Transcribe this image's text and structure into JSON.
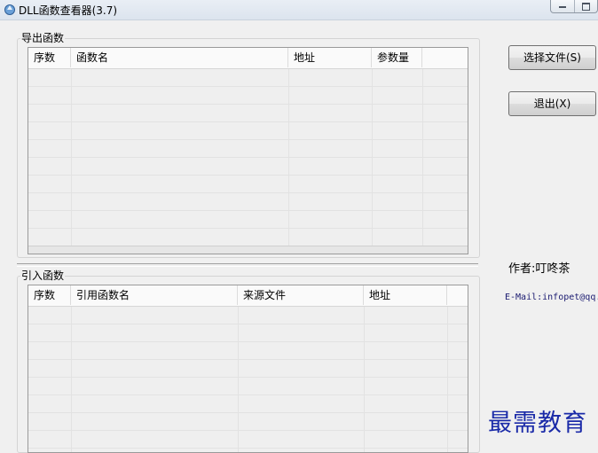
{
  "window": {
    "title": "DLL函数查看器(3.7)"
  },
  "exports": {
    "group_label": "导出函数",
    "columns": [
      "序数",
      "函数名",
      "地址",
      "参数量"
    ]
  },
  "imports": {
    "group_label": "引入函数",
    "columns": [
      "序数",
      "引用函数名",
      "来源文件",
      "地址"
    ]
  },
  "buttons": {
    "select_file": "选择文件(S)",
    "exit": "退出(X)"
  },
  "author": "作者:叮咚茶",
  "email": "E-Mail:infopet@qq.c",
  "watermark": "最需教育"
}
